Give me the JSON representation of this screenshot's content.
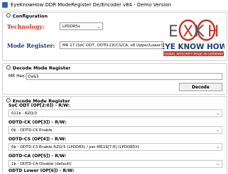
{
  "window": {
    "title": "EyeKnowHow DDR ModeRegister De/Encoder v84 - Demo Version"
  },
  "config": {
    "title": "Configuration",
    "technology_label": "Technology:",
    "technology_value": "LPDDR5x",
    "mode_register_label": "Mode Register:",
    "mode_register_value": "MR 17 (SoC ODT, ODTD-CK/CS/CA, x8 Upper/Lower)"
  },
  "logo": {
    "letters": [
      "E",
      "X",
      "K",
      "H"
    ],
    "name": "EYE KNOW HOW",
    "tagline": "SIGNAL INTEGRITY MADE IN GERMANY",
    "accent_color": "#c0392b"
  },
  "decode": {
    "title": "Decode Mode Register",
    "hex_label": "MR Hex:",
    "hex_value": "0x63",
    "button_label": "Decode"
  },
  "encode": {
    "title": "Encode Mode Register",
    "fields": [
      {
        "label": "SoC ODT (OP[2:0]) - R/W:",
        "value": "011b - RZQ/3"
      },
      {
        "label": "ODTD-CK (OP[3]) - R/W:",
        "value": "0b - ODTD-CK Enable"
      },
      {
        "label": "ODTD-CS (OP[4]) - R/W:",
        "value": "0b - ODTD-CS Enable RZQ/3 (LPDDR5) / per MR19[7:6] (LPDDR5X)"
      },
      {
        "label": "ODTD-CA (OP[5]) - R/W:",
        "value": "1b - ODTD-CA Disable (default)"
      },
      {
        "label": "ODTD Lower (OP[6]) - R/W:"
      }
    ]
  }
}
